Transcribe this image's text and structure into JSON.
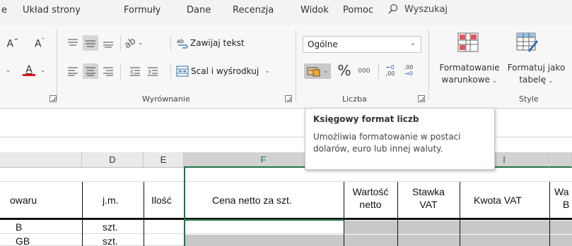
{
  "tabs": [
    "e",
    "Układ strony",
    "Formuły",
    "Dane",
    "Recenzja",
    "Widok",
    "Pomoc"
  ],
  "search": {
    "label": "Wyszukaj",
    "icon": "search-icon"
  },
  "font_group": {
    "grow": "A",
    "shrink": "A",
    "font_color": "A"
  },
  "alignment": {
    "wrap_label": "Zawijaj tekst",
    "merge_label": "Scal i wyśrodkuj",
    "group_label": "Wyrównanie"
  },
  "number": {
    "format_value": "Ogólne",
    "percent": "%",
    "thousands": "000",
    "inc_decimal": ",00",
    "dec_decimal": ",00",
    "group_label": "Liczba"
  },
  "styles": {
    "cond_format_line1": "Formatowanie",
    "cond_format_line2": "warunkowe",
    "format_table_line1": "Formatuj jako",
    "format_table_line2": "tabelę",
    "group_label": "Style"
  },
  "tooltip": {
    "title": "Księgowy format liczb",
    "body_line1": "Umożliwia formatowanie w postaci",
    "body_line2": "dolarów, euro lub innej waluty."
  },
  "columns": [
    "D",
    "E",
    "F",
    "I"
  ],
  "table": {
    "h_towar": "owaru",
    "h_jm": "j.m.",
    "h_ilosc": "Ilość",
    "h_cena": "Cena netto za szt.",
    "h_wartosc1": "Wartość",
    "h_wartosc2": "netto",
    "h_stawka1": "Stawka",
    "h_stawka2": "VAT",
    "h_kwota": "Kwota VAT",
    "h_wb1": "Wa",
    "h_wb2": "B",
    "r1_towar": "B",
    "r1_jm": "szt.",
    "r2_towar": "GB",
    "r2_jm": "szt."
  },
  "colors": {
    "selection": "#217346",
    "font_red": "#e81123"
  }
}
